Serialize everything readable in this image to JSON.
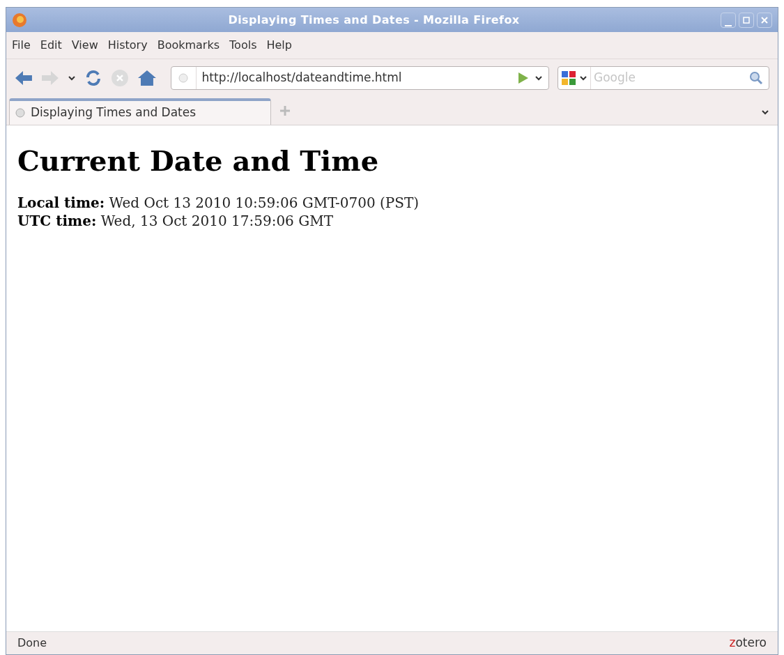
{
  "window": {
    "title": "Displaying Times and Dates - Mozilla Firefox"
  },
  "menu": [
    "File",
    "Edit",
    "View",
    "History",
    "Bookmarks",
    "Tools",
    "Help"
  ],
  "toolbar": {
    "url": "http://localhost/dateandtime.html",
    "search": {
      "placeholder": "Google"
    }
  },
  "tabs": [
    {
      "label": "Displaying Times and Dates",
      "selected": true
    }
  ],
  "page": {
    "heading": "Current Date and Time",
    "lines": [
      {
        "label": "Local time:",
        "value": "Wed Oct 13 2010 10:59:06 GMT-0700 (PST)"
      },
      {
        "label": "UTC time:",
        "value": "Wed, 13 Oct 2010 17:59:06 GMT"
      }
    ]
  },
  "status_bar": {
    "text": "Done",
    "addon": "zotero"
  }
}
